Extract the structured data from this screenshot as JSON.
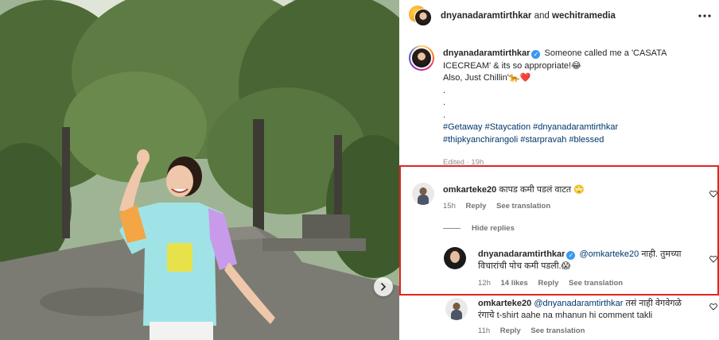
{
  "header": {
    "user": "dnyanadaramtirthkar",
    "and_text": "and",
    "collab_user": "wechitramedia"
  },
  "caption": {
    "user": "dnyanadaramtirthkar",
    "text1": "Someone called me a 'CASATA ICECREAM' & its so appropriate!😂",
    "text2": "Also, Just Chillin'🐆❤️",
    "dot": ".",
    "hashtags_line1": "#Getaway #Staycation #dnyanadaramtirthkar",
    "hashtags_line2": "#thipkyanchirangoli #starpravah #blessed",
    "edited": "Edited · 19h"
  },
  "comments": [
    {
      "user": "omkarteke20",
      "text": "कापड कमी पडलं वाटत 🙄",
      "time": "15h",
      "reply": "Reply",
      "translate": "See translation"
    }
  ],
  "hide_replies": "Hide replies",
  "replies": [
    {
      "user": "dnyanadaramtirthkar",
      "mention": "@omkarteke20",
      "text_line1": "नाही. तुमच्या",
      "text_line2": "विचारांची पोच कमी पडली.😱",
      "time": "12h",
      "likes": "14 likes",
      "reply": "Reply",
      "translate": "See translation"
    },
    {
      "user": "omkarteke20",
      "mention": "@dnyanadaramtirthkar",
      "text_line1": "तसं नाही वेगवेगळे",
      "text_line2": "रंगाचे t-shirt aahe na mhanun hi comment takli",
      "time": "11h",
      "reply": "Reply",
      "translate": "See translation"
    }
  ],
  "icons": [
    "more-options-icon",
    "heart-icon",
    "chevron-right-icon",
    "verified-badge-icon"
  ],
  "colors": {
    "highlight": "#e0261f",
    "verified": "#3897f0",
    "link": "#00376b"
  }
}
